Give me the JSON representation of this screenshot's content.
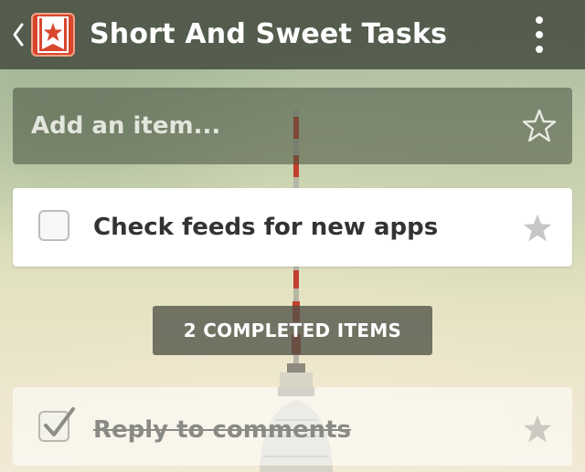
{
  "header": {
    "title": "Short And Sweet Tasks",
    "back_icon": "chevron-left-icon",
    "app_icon": "wunderlist-star-icon",
    "menu_icon": "overflow-menu-icon"
  },
  "add_item": {
    "placeholder": "Add an item...",
    "star_icon": "star-outline-icon"
  },
  "tasks": [
    {
      "label": "Check feeds for new apps",
      "completed": false,
      "starred": false
    }
  ],
  "completed_toggle": {
    "label": "2 COMPLETED ITEMS"
  },
  "completed_tasks": [
    {
      "label": "Reply to comments",
      "completed": true,
      "starred": false
    }
  ],
  "colors": {
    "header_bg": "#42483c",
    "app_icon": "#d8462e",
    "card_bg": "#ffffff",
    "task_text": "#333333",
    "star": "#c6c6c6"
  }
}
